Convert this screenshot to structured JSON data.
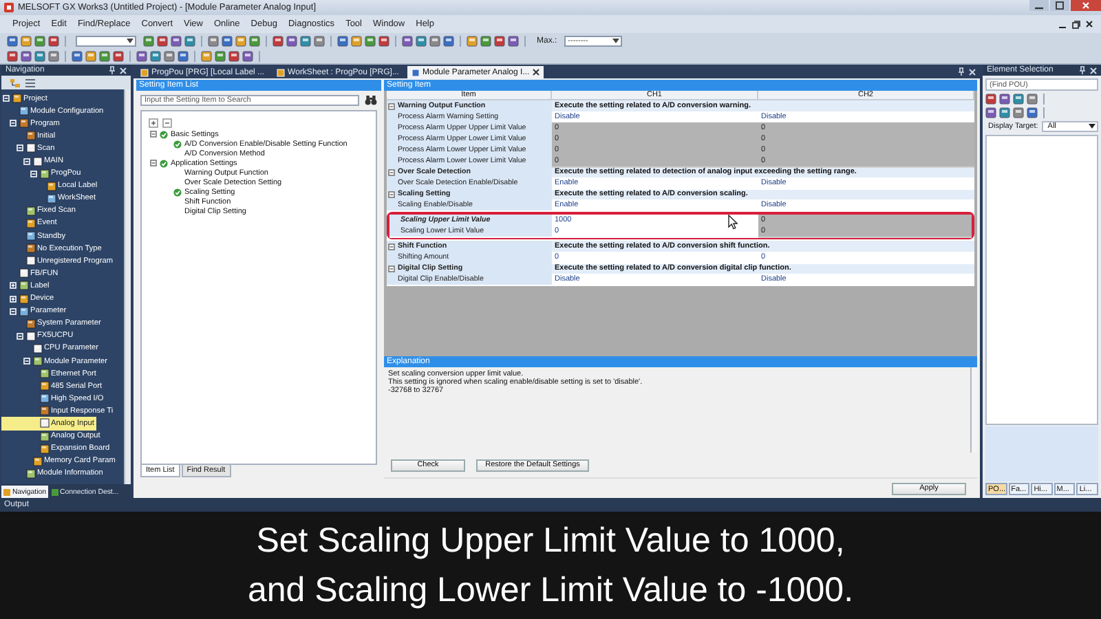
{
  "window": {
    "title": "MELSOFT GX Works3 (Untitled Project) - [Module Parameter Analog Input]"
  },
  "menu": [
    "Project",
    "Edit",
    "Find/Replace",
    "Convert",
    "View",
    "Online",
    "Debug",
    "Diagnostics",
    "Tool",
    "Window",
    "Help"
  ],
  "toolbar": {
    "max_label": "Max.:",
    "max_value": "--------"
  },
  "navigation": {
    "title": "Navigation",
    "tree": [
      {
        "label": "Project",
        "selected": false,
        "expanded": true,
        "children": [
          {
            "label": "Module Configuration",
            "selected": false
          },
          {
            "label": "Program",
            "selected": false,
            "expanded": true,
            "children": [
              {
                "label": "Initial",
                "selected": false
              },
              {
                "label": "Scan",
                "selected": false,
                "expanded": true,
                "children": [
                  {
                    "label": "MAIN",
                    "selected": false,
                    "expanded": true,
                    "children": [
                      {
                        "label": "ProgPou",
                        "selected": false,
                        "expanded": true,
                        "children": [
                          {
                            "label": "Local Label",
                            "selected": false
                          },
                          {
                            "label": "WorkSheet",
                            "selected": false
                          }
                        ]
                      }
                    ]
                  }
                ]
              },
              {
                "label": "Fixed Scan",
                "selected": false
              },
              {
                "label": "Event",
                "selected": false
              },
              {
                "label": "Standby",
                "selected": false
              },
              {
                "label": "No Execution Type",
                "selected": false
              },
              {
                "label": "Unregistered Program",
                "selected": false
              }
            ]
          },
          {
            "label": "FB/FUN",
            "selected": false
          },
          {
            "label": "Label",
            "selected": false,
            "expanded": false
          },
          {
            "label": "Device",
            "selected": false,
            "expanded": false
          },
          {
            "label": "Parameter",
            "selected": false,
            "expanded": true,
            "children": [
              {
                "label": "System Parameter",
                "selected": false
              },
              {
                "label": "FX5UCPU",
                "selected": false,
                "expanded": true,
                "children": [
                  {
                    "label": "CPU Parameter",
                    "selected": false
                  },
                  {
                    "label": "Module Parameter",
                    "selected": false,
                    "expanded": true,
                    "children": [
                      {
                        "label": "Ethernet Port",
                        "selected": false
                      },
                      {
                        "label": "485 Serial Port",
                        "selected": false
                      },
                      {
                        "label": "High Speed I/O",
                        "selected": false
                      },
                      {
                        "label": "Input Response Ti",
                        "selected": false
                      },
                      {
                        "label": "Analog Input",
                        "selected": true
                      },
                      {
                        "label": "Analog Output",
                        "selected": false
                      },
                      {
                        "label": "Expansion Board",
                        "selected": false
                      }
                    ]
                  },
                  {
                    "label": "Memory Card Param",
                    "selected": false
                  }
                ]
              },
              {
                "label": "Module Information",
                "selected": false
              }
            ]
          }
        ]
      }
    ],
    "tabs": [
      {
        "label": "Navigation",
        "selected": true
      },
      {
        "label": "Connection Dest...",
        "selected": false
      }
    ]
  },
  "document_tabs": [
    {
      "label": "ProgPou [PRG] [Local Label ...",
      "selected": false
    },
    {
      "label": "WorkSheet : ProgPou [PRG]...",
      "selected": false
    },
    {
      "label": "Module Parameter Analog I...",
      "selected": true
    }
  ],
  "setting_item_list": {
    "title": "Setting Item List",
    "search": {
      "placeholder": "Input the Setting Item to Search"
    },
    "tree": [
      {
        "label": "Basic Settings",
        "configured": true,
        "expanded": true,
        "children": [
          {
            "label": "A/D Conversion Enable/Disable Setting Function",
            "configured": true
          },
          {
            "label": "A/D Conversion Method",
            "configured": false
          }
        ]
      },
      {
        "label": "Application Settings",
        "configured": true,
        "expanded": true,
        "children": [
          {
            "label": "Warning Output Function",
            "configured": false
          },
          {
            "label": "Over Scale Detection Setting",
            "configured": false
          },
          {
            "label": "Scaling Setting",
            "configured": true
          },
          {
            "label": "Shift Function",
            "configured": false
          },
          {
            "label": "Digital Clip Setting",
            "configured": false
          }
        ]
      }
    ],
    "tabs": [
      {
        "label": "Item List",
        "selected": true
      },
      {
        "label": "Find Result",
        "selected": false
      }
    ]
  },
  "setting_item": {
    "title": "Setting Item",
    "columns": [
      "Item",
      "CH1",
      "CH2"
    ],
    "rows": [
      {
        "kind": "group",
        "expanded": true,
        "item": "Warning Output Function",
        "description": "Execute the setting related to A/D conversion warning."
      },
      {
        "kind": "setting",
        "item": "Process Alarm Warning Setting",
        "changed": false,
        "highlighted": false,
        "ch1": {
          "value": "Disable",
          "disabled": false
        },
        "ch2": {
          "value": "Disable",
          "disabled": false
        }
      },
      {
        "kind": "setting",
        "item": "Process Alarm Upper Upper Limit Value",
        "changed": false,
        "highlighted": false,
        "ch1": {
          "value": "0",
          "disabled": true
        },
        "ch2": {
          "value": "0",
          "disabled": true
        }
      },
      {
        "kind": "setting",
        "item": "Process Alarm Upper Lower Limit Value",
        "changed": false,
        "highlighted": false,
        "ch1": {
          "value": "0",
          "disabled": true
        },
        "ch2": {
          "value": "0",
          "disabled": true
        }
      },
      {
        "kind": "setting",
        "item": "Process Alarm Lower Upper Limit Value",
        "changed": false,
        "highlighted": false,
        "ch1": {
          "value": "0",
          "disabled": true
        },
        "ch2": {
          "value": "0",
          "disabled": true
        }
      },
      {
        "kind": "setting",
        "item": "Process Alarm Lower Lower Limit Value",
        "changed": false,
        "highlighted": false,
        "ch1": {
          "value": "0",
          "disabled": true
        },
        "ch2": {
          "value": "0",
          "disabled": true
        }
      },
      {
        "kind": "group",
        "expanded": true,
        "item": "Over Scale Detection",
        "description": "Execute the setting related to detection of analog input exceeding the setting range."
      },
      {
        "kind": "setting",
        "item": "Over Scale Detection Enable/Disable",
        "changed": false,
        "highlighted": false,
        "ch1": {
          "value": "Enable",
          "disabled": false
        },
        "ch2": {
          "value": "Disable",
          "disabled": false
        }
      },
      {
        "kind": "group",
        "expanded": true,
        "item": "Scaling Setting",
        "description": "Execute the setting related to A/D conversion scaling."
      },
      {
        "kind": "setting",
        "item": "Scaling Enable/Disable",
        "changed": false,
        "highlighted": false,
        "ch1": {
          "value": "Enable",
          "disabled": false
        },
        "ch2": {
          "value": "Disable",
          "disabled": false
        }
      },
      {
        "kind": "setting",
        "item": "Scaling Upper Limit Value",
        "changed": true,
        "highlighted": true,
        "ch1": {
          "value": "1000",
          "disabled": false
        },
        "ch2": {
          "value": "0",
          "disabled": true
        }
      },
      {
        "kind": "setting",
        "item": "Scaling Lower Limit Value",
        "changed": false,
        "highlighted": true,
        "ch1": {
          "value": "0",
          "disabled": false
        },
        "ch2": {
          "value": "0",
          "disabled": true
        }
      },
      {
        "kind": "group",
        "expanded": true,
        "item": "Shift Function",
        "description": "Execute the setting related to A/D conversion shift function."
      },
      {
        "kind": "setting",
        "item": "Shifting Amount",
        "changed": false,
        "highlighted": false,
        "ch1": {
          "value": "0",
          "disabled": false
        },
        "ch2": {
          "value": "0",
          "disabled": false
        }
      },
      {
        "kind": "group",
        "expanded": true,
        "item": "Digital Clip Setting",
        "description": "Execute the setting related to A/D conversion digital clip function."
      },
      {
        "kind": "setting",
        "item": "Digital Clip Enable/Disable",
        "changed": false,
        "highlighted": false,
        "ch1": {
          "value": "Disable",
          "disabled": false
        },
        "ch2": {
          "value": "Disable",
          "disabled": false
        }
      }
    ]
  },
  "explanation": {
    "title": "Explanation",
    "lines": [
      "Set scaling conversion upper limit value.",
      "This setting is ignored when scaling enable/disable setting is set to 'disable'.",
      "-32768 to 32767"
    ]
  },
  "buttons": [
    {
      "label": "Check"
    },
    {
      "label": "Restore the Default Settings"
    }
  ],
  "apply": {
    "label": "Apply"
  },
  "element_selection": {
    "title": "Element Selection",
    "search": {
      "placeholder": "(Find POU)"
    },
    "display_target_label": "Display Target:",
    "display_target": "All",
    "tabs": [
      {
        "label": "PO...",
        "selected": true
      },
      {
        "label": "Fa...",
        "selected": false
      },
      {
        "label": "Hi...",
        "selected": false
      },
      {
        "label": "M...",
        "selected": false
      },
      {
        "label": "Li...",
        "selected": false
      }
    ]
  },
  "output": {
    "title": "Output"
  },
  "caption": [
    "Set Scaling Upper Limit Value to 1000,",
    "and Scaling Lower Limit Value to -1000."
  ]
}
